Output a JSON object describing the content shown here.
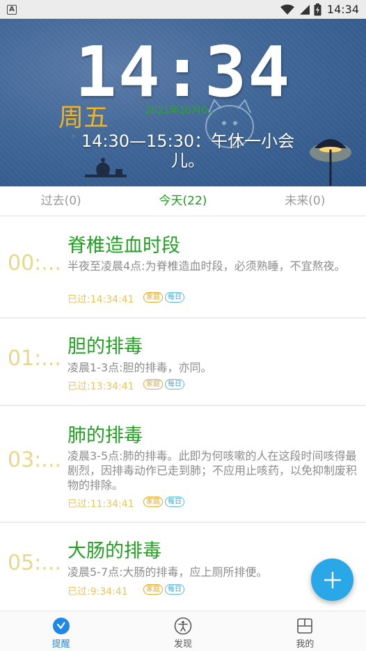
{
  "status_bar": {
    "time": "14:34",
    "left_icon": "a-icon",
    "icons": [
      "wifi-icon",
      "signal-icon",
      "battery-charging-icon"
    ]
  },
  "header": {
    "clock": "14:34",
    "weekday": "周五",
    "date": "2021年10月0...",
    "schedule_line1": "14:30—15:30：午休一小会",
    "schedule_line2": "儿。",
    "weekday_color": "#f2b21c",
    "date_color": "#2aa42a"
  },
  "tabs": [
    {
      "label": "过去(0)",
      "active": false
    },
    {
      "label": "今天(22)",
      "active": true
    },
    {
      "label": "未来(0)",
      "active": false
    }
  ],
  "items": [
    {
      "hour": "00:...",
      "title": "脊椎造血时段",
      "desc": "半夜至凌晨4点:为脊椎造血时段，必须熟睡，不宜熬夜。",
      "passed": "已过:14:34:41",
      "tags": [
        "家庭",
        "每日"
      ]
    },
    {
      "hour": "01:...",
      "title": "胆的排毒",
      "desc": "凌晨1-3点:胆的排毒，亦同。",
      "passed": "已过:13:34:41",
      "tags": [
        "家庭",
        "每日"
      ]
    },
    {
      "hour": "03:...",
      "title": "肺的排毒",
      "desc": "凌晨3-5点:肺的排毒。此即为何咳嗽的人在这段时间咳得最剧烈，因排毒动作已走到肺；不应用止咳药，以免抑制废积物的排除。",
      "passed": "已过:11:34:41",
      "tags": [
        "家庭",
        "每日"
      ]
    },
    {
      "hour": "05:...",
      "title": "大肠的排毒",
      "desc": "凌晨5-7点:大肠的排毒，应上厕所排便。",
      "passed": "已过:9:34:41",
      "tags": [
        "家庭",
        "每日"
      ]
    }
  ],
  "fab": {
    "icon": "plus-icon",
    "color": "#2aa7e6"
  },
  "bottom_nav": [
    {
      "label": "提醒",
      "icon": "clock-icon",
      "active": true
    },
    {
      "label": "发现",
      "icon": "accessibility-icon",
      "active": false
    },
    {
      "label": "我的",
      "icon": "profile-icon",
      "active": false
    }
  ],
  "colors": {
    "title_green": "#22a022",
    "hour_yellow": "#e8d88a",
    "passed_yellow": "#e8c55a",
    "active_tab": "#1e9a1e",
    "nav_active": "#1e88e5"
  }
}
